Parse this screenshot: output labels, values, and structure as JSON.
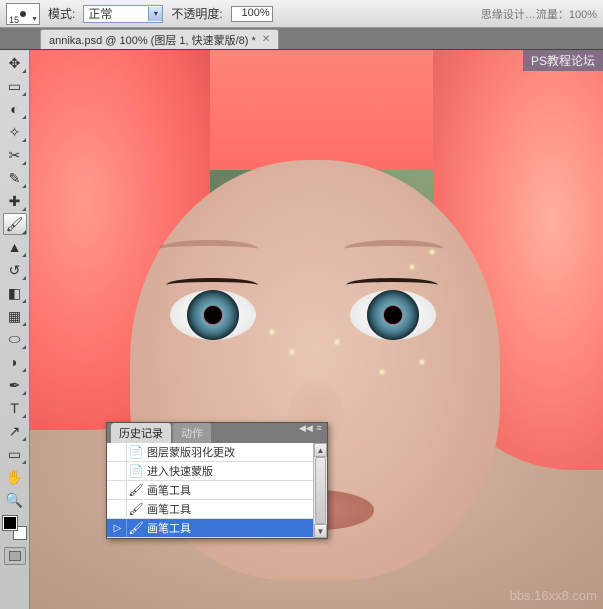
{
  "options_bar": {
    "brush_size": "15",
    "mode_label": "模式:",
    "mode_value": "正常",
    "opacity_label": "不透明度:",
    "opacity_value": "100%",
    "flow_hint": "思缘设计…流量：100%"
  },
  "document_tab": {
    "title": "annika.psd @ 100% (图层 1, 快速蒙版/8) *"
  },
  "history_panel": {
    "tab_history": "历史记录",
    "tab_actions": "动作",
    "items": [
      {
        "icon": "📄",
        "label": "图层蒙版羽化更改"
      },
      {
        "icon": "📄",
        "label": "进入快速蒙版"
      },
      {
        "icon": "🖌",
        "label": "画笔工具"
      },
      {
        "icon": "🖌",
        "label": "画笔工具"
      },
      {
        "icon": "🖌",
        "label": "画笔工具"
      }
    ],
    "selected_index": 4,
    "cursor_marker": "▷"
  },
  "watermarks": {
    "top_right": "PS教程论坛",
    "bottom_right": "bbs.16xx8.com"
  },
  "tool_icons": {
    "move": "✥",
    "marquee": "▭",
    "lasso": "◐",
    "wand": "✧",
    "crop": "✂",
    "eyedropper": "✎",
    "heal": "✚",
    "brush": "🖌",
    "stamp": "▲",
    "history_brush": "↺",
    "eraser": "◧",
    "gradient": "▦",
    "blur": "⬭",
    "dodge": "◗",
    "pen": "✒",
    "text": "T",
    "path": "↗",
    "shape": "▭",
    "hand": "✋",
    "zoom": "🔍"
  }
}
